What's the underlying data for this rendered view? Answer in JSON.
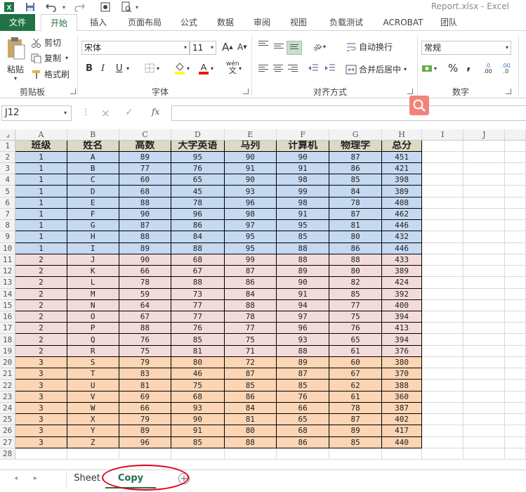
{
  "title": "Report.xlsx - Excel",
  "qat": {
    "excel_logo": "excel-logo",
    "save": "save-icon",
    "undo": "undo-icon",
    "redo": "redo-icon",
    "touch": "touch-mode-icon",
    "preview": "print-preview-icon"
  },
  "tabs": [
    "文件",
    "开始",
    "插入",
    "页面布局",
    "公式",
    "数据",
    "审阅",
    "视图",
    "负载测试",
    "ACROBAT",
    "团队"
  ],
  "active_tab": "开始",
  "ribbon": {
    "clipboard": {
      "paste": "粘贴",
      "cut": "剪切",
      "copy": "复制",
      "format_painter": "格式刷",
      "label": "剪贴板"
    },
    "font": {
      "name": "宋体",
      "size": "11",
      "label": "字体",
      "grow": "A",
      "shrink": "A",
      "bold": "B",
      "italic": "I",
      "underline": "U",
      "phonetic": "wén"
    },
    "alignment": {
      "wrap": "自动换行",
      "merge": "合并后居中",
      "label": "对齐方式"
    },
    "number": {
      "format": "常规",
      "percent": "%",
      "comma": ",",
      "inc_dec_1": ".0",
      "inc_dec_2": ".00",
      "label": "数字"
    }
  },
  "formula_bar": {
    "name_box": "J12",
    "cancel": "×",
    "enter": "✓",
    "fx": "fx",
    "value": ""
  },
  "columns": [
    "A",
    "B",
    "C",
    "D",
    "E",
    "F",
    "G",
    "H",
    "I",
    "J"
  ],
  "headers": [
    "班级",
    "姓名",
    "高数",
    "大学英语",
    "马列",
    "计算机",
    "物理学",
    "总分"
  ],
  "rows": [
    [
      "1",
      "A",
      "89",
      "95",
      "90",
      "90",
      "87",
      "451"
    ],
    [
      "1",
      "B",
      "77",
      "76",
      "91",
      "91",
      "86",
      "421"
    ],
    [
      "1",
      "C",
      "60",
      "65",
      "90",
      "98",
      "85",
      "398"
    ],
    [
      "1",
      "D",
      "68",
      "45",
      "93",
      "99",
      "84",
      "389"
    ],
    [
      "1",
      "E",
      "88",
      "78",
      "96",
      "98",
      "78",
      "408"
    ],
    [
      "1",
      "F",
      "90",
      "96",
      "98",
      "91",
      "87",
      "462"
    ],
    [
      "1",
      "G",
      "87",
      "86",
      "97",
      "95",
      "81",
      "446"
    ],
    [
      "1",
      "H",
      "88",
      "84",
      "95",
      "85",
      "80",
      "432"
    ],
    [
      "1",
      "I",
      "89",
      "88",
      "95",
      "88",
      "86",
      "446"
    ],
    [
      "2",
      "J",
      "90",
      "68",
      "99",
      "88",
      "88",
      "433"
    ],
    [
      "2",
      "K",
      "66",
      "67",
      "87",
      "89",
      "80",
      "389"
    ],
    [
      "2",
      "L",
      "78",
      "88",
      "86",
      "90",
      "82",
      "424"
    ],
    [
      "2",
      "M",
      "59",
      "73",
      "84",
      "91",
      "85",
      "392"
    ],
    [
      "2",
      "N",
      "64",
      "77",
      "88",
      "94",
      "77",
      "400"
    ],
    [
      "2",
      "O",
      "67",
      "77",
      "78",
      "97",
      "75",
      "394"
    ],
    [
      "2",
      "P",
      "88",
      "76",
      "77",
      "96",
      "76",
      "413"
    ],
    [
      "2",
      "Q",
      "76",
      "85",
      "75",
      "93",
      "65",
      "394"
    ],
    [
      "2",
      "R",
      "75",
      "81",
      "71",
      "88",
      "61",
      "376"
    ],
    [
      "3",
      "S",
      "79",
      "80",
      "72",
      "89",
      "60",
      "380"
    ],
    [
      "3",
      "T",
      "83",
      "46",
      "87",
      "87",
      "67",
      "370"
    ],
    [
      "3",
      "U",
      "81",
      "75",
      "85",
      "85",
      "62",
      "388"
    ],
    [
      "3",
      "V",
      "69",
      "68",
      "86",
      "76",
      "61",
      "360"
    ],
    [
      "3",
      "W",
      "66",
      "93",
      "84",
      "66",
      "78",
      "387"
    ],
    [
      "3",
      "X",
      "79",
      "90",
      "81",
      "65",
      "87",
      "402"
    ],
    [
      "3",
      "Y",
      "89",
      "91",
      "80",
      "68",
      "89",
      "417"
    ],
    [
      "3",
      "Z",
      "96",
      "85",
      "88",
      "86",
      "85",
      "440"
    ]
  ],
  "row_numbers": [
    "1",
    "2",
    "3",
    "4",
    "5",
    "6",
    "7",
    "8",
    "9",
    "10",
    "11",
    "12",
    "13",
    "14",
    "15",
    "16",
    "17",
    "18",
    "19",
    "20",
    "21",
    "22",
    "23",
    "24",
    "25",
    "26",
    "27",
    "28"
  ],
  "colors": {
    "header_fill": "#ddd9c4",
    "class1_fill": "#c5d9f1",
    "class2_fill": "#f2dcdb",
    "class3_fill": "#fcd5b4",
    "excel_green": "#217346",
    "annotation": "#e0001b"
  },
  "sheets": {
    "tab1": "Sheet",
    "tab2": "Copy",
    "active": "Copy"
  }
}
